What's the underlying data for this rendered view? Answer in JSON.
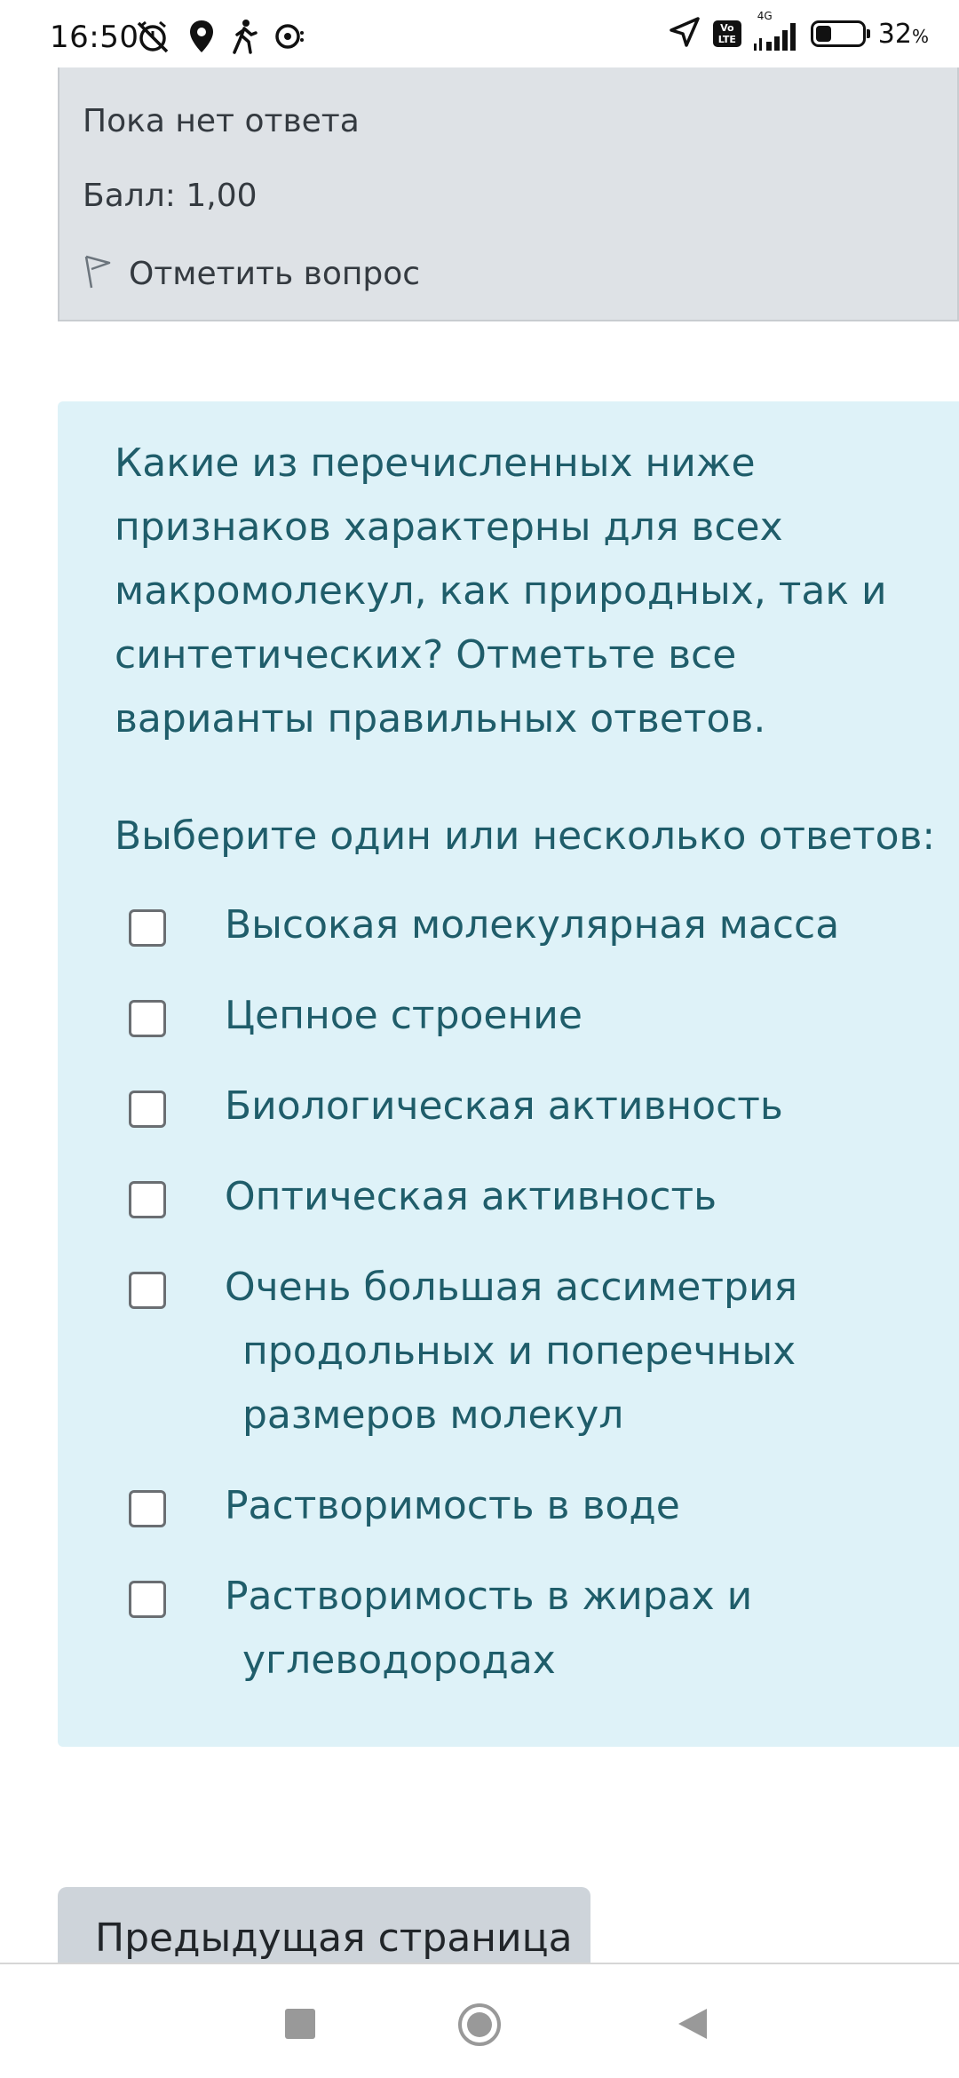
{
  "status_bar": {
    "time": "16:50",
    "network": "4G",
    "volte": "Vo LTE",
    "battery_percent": "32",
    "battery_unit": "%",
    "icons": [
      "muted-alarm-icon",
      "location-pin-icon",
      "walking-icon",
      "chat-icon",
      "navigation-arrow-icon",
      "volte-icon",
      "signal-icon",
      "battery-icon"
    ]
  },
  "previous_question": {
    "status": "Пока нет ответа",
    "score": "Балл: 1,00",
    "flag_label": "Отметить вопрос"
  },
  "question": {
    "text": "Какие из перечисленных ниже признаков характерны для всех макромолекул, как природных, так и синтетических? Отметьте все варианты правильных ответов.",
    "prompt": "Выберите один или несколько ответов:",
    "options": [
      {
        "label": "Высокая молекулярная масса",
        "checked": false
      },
      {
        "label": "Цепное строение",
        "checked": false
      },
      {
        "label": "Биологическая активность",
        "checked": false
      },
      {
        "label": "Оптическая активность",
        "checked": false
      },
      {
        "label": "Очень большая ассиметрия продольных и поперечных размеров молекул",
        "checked": false
      },
      {
        "label": "Растворимость в воде",
        "checked": false
      },
      {
        "label": "Растворимость в жирах и углеводородах",
        "checked": false
      }
    ]
  },
  "navigation": {
    "prev_page_label": "Предыдущая страница"
  },
  "colors": {
    "question_bg": "#def2f8",
    "question_text": "#1f5d6a",
    "info_card_bg": "#dee2e6",
    "button_bg": "#ced4da"
  },
  "system_nav": {
    "icons": [
      "recents-icon",
      "home-icon",
      "back-icon"
    ]
  }
}
